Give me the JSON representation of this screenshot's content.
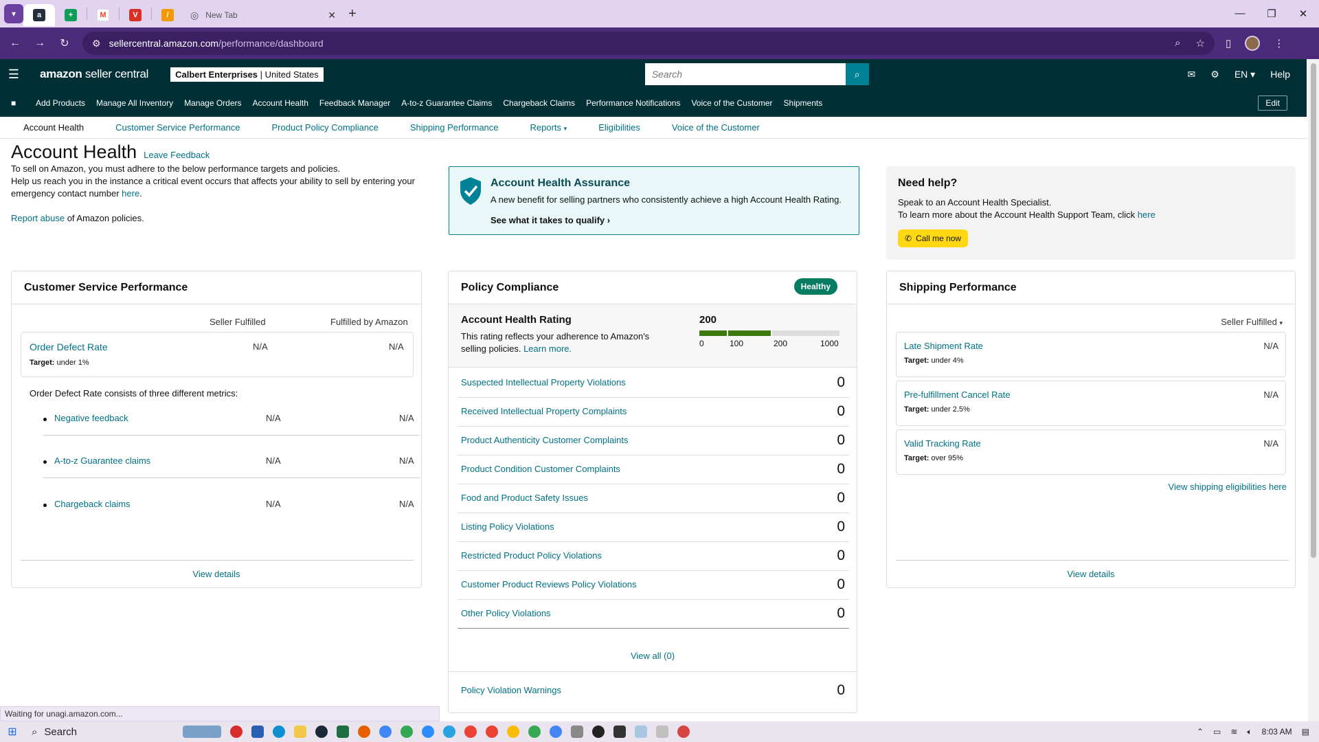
{
  "browser": {
    "tabs": [
      {
        "name": "amazon-tab",
        "glyph": "a",
        "color": "#232f3e"
      },
      {
        "name": "sheets-tab",
        "glyph": "+",
        "color": "#0f9d58"
      },
      {
        "name": "gmail-tab",
        "glyph": "M",
        "color": "#ea4335"
      },
      {
        "name": "vivaldi-tab",
        "glyph": "V",
        "color": "#d93025"
      },
      {
        "name": "tool-tab",
        "glyph": "/",
        "color": "#f29900"
      }
    ],
    "active_tab_title": "New Tab",
    "url_host": "sellercentral.amazon.com",
    "url_path": "/performance/dashboard",
    "status_text": "Waiting for unagi.amazon.com..."
  },
  "header": {
    "logo_bold": "amazon",
    "logo_light": " seller central",
    "account_name": "Calbert Enterprises",
    "account_region": "| United States",
    "search_placeholder": "Search",
    "lang": "EN",
    "help": "Help"
  },
  "nav": {
    "items": [
      "Add Products",
      "Manage All Inventory",
      "Manage Orders",
      "Account Health",
      "Feedback Manager",
      "A-to-z Guarantee Claims",
      "Chargeback Claims",
      "Performance Notifications",
      "Voice of the Customer",
      "Shipments"
    ],
    "edit": "Edit"
  },
  "subnav": {
    "items": [
      "Account Health",
      "Customer Service Performance",
      "Product Policy Compliance",
      "Shipping Performance",
      "Reports",
      "Eligibilities",
      "Voice of the Customer"
    ]
  },
  "intro": {
    "title": "Account Health",
    "leave_feedback": "Leave Feedback",
    "line1": "To sell on Amazon, you must adhere to the below performance targets and policies.",
    "line2": "Help us reach you in the instance a critical event occurs that affects your ability to sell by entering your emergency contact number",
    "here": "here",
    "report_abuse": "Report abuse",
    "report_suffix": "of Amazon policies."
  },
  "assurance": {
    "title": "Account Health Assurance",
    "desc": "A new benefit for selling partners who consistently achieve a high Account Health Rating.",
    "qualify": "See what it takes to qualify"
  },
  "need_help": {
    "title": "Need help?",
    "line1": "Speak to an Account Health Specialist.",
    "line2": "To learn more about the Account Health Support Team, click",
    "here": "here",
    "call": "Call me now"
  },
  "csp": {
    "title": "Customer Service Performance",
    "col1": "Seller Fulfilled",
    "col2": "Fulfilled by Amazon",
    "odr_name": "Order Defect Rate",
    "odr_target_label": "Target:",
    "odr_target": "under 1%",
    "odr_sf": "N/A",
    "odr_fba": "N/A",
    "odr_desc": "Order Defect Rate consists of three different metrics:",
    "metrics": [
      {
        "name": "Negative feedback",
        "sf": "N/A",
        "fba": "N/A"
      },
      {
        "name": "A-to-z Guarantee claims",
        "sf": "N/A",
        "fba": "N/A"
      },
      {
        "name": "Chargeback claims",
        "sf": "N/A",
        "fba": "N/A"
      }
    ],
    "view_details": "View details"
  },
  "policy": {
    "title": "Policy Compliance",
    "status": "Healthy",
    "ahr_title": "Account Health Rating",
    "ahr_desc": "This rating reflects your adherence to Amazon's selling policies.",
    "learn_more": "Learn more.",
    "score": "200",
    "ticks": [
      "0",
      "100",
      "200",
      "1000"
    ],
    "violations": [
      {
        "name": "Suspected Intellectual Property Violations",
        "count": "0"
      },
      {
        "name": "Received Intellectual Property Complaints",
        "count": "0"
      },
      {
        "name": "Product Authenticity Customer Complaints",
        "count": "0"
      },
      {
        "name": "Product Condition Customer Complaints",
        "count": "0"
      },
      {
        "name": "Food and Product Safety Issues",
        "count": "0"
      },
      {
        "name": "Listing Policy Violations",
        "count": "0"
      },
      {
        "name": "Restricted Product Policy Violations",
        "count": "0"
      },
      {
        "name": "Customer Product Reviews Policy Violations",
        "count": "0"
      },
      {
        "name": "Other Policy Violations",
        "count": "0"
      }
    ],
    "view_all": "View all (0)",
    "warnings_name": "Policy Violation Warnings",
    "warnings_count": "0",
    "colors": {
      "good": "#067d62",
      "bar_good": "#3b7a0b",
      "bar_empty": "#ddd"
    }
  },
  "shipping": {
    "title": "Shipping Performance",
    "selector": "Seller Fulfilled",
    "metrics": [
      {
        "name": "Late Shipment Rate",
        "target_label": "Target:",
        "target": "under 4%",
        "value": "N/A"
      },
      {
        "name": "Pre-fulfillment Cancel Rate",
        "target_label": "Target:",
        "target": "under 2.5%",
        "value": "N/A"
      },
      {
        "name": "Valid Tracking Rate",
        "target_label": "Target:",
        "target": "over 95%",
        "value": "N/A"
      }
    ],
    "eligibilities": "View shipping eligibilities here",
    "view_details": "View details"
  },
  "taskbar": {
    "search": "Search",
    "time": "8:03 AM"
  }
}
